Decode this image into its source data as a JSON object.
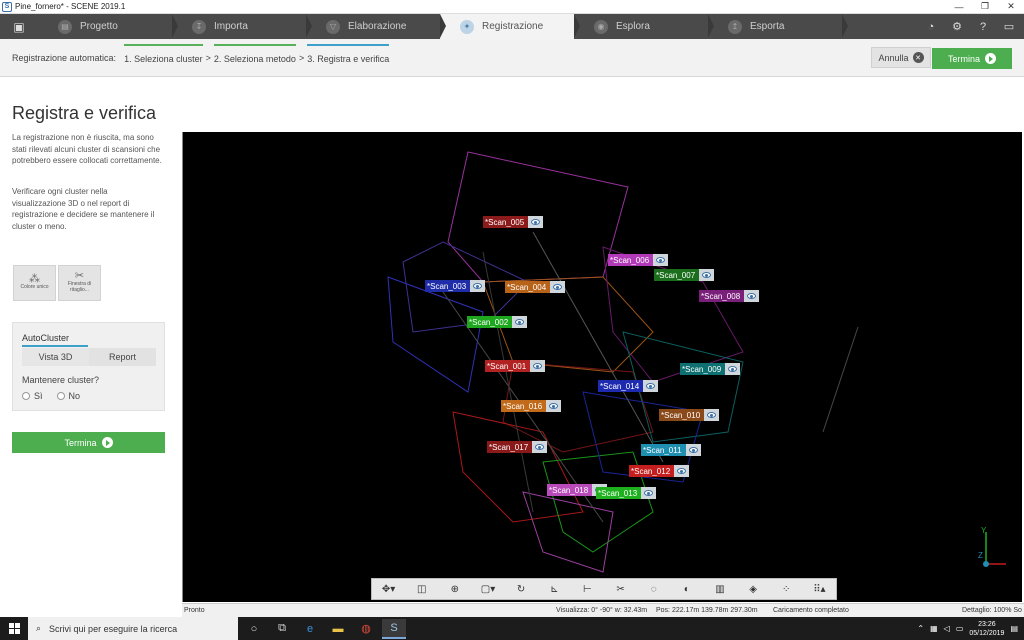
{
  "window": {
    "title": "Pine_fornero* - SCENE 2019.1",
    "app_icon": "S"
  },
  "workflow": {
    "steps": [
      {
        "label": "Progetto",
        "icon": "folder-icon"
      },
      {
        "label": "Importa",
        "icon": "import-icon"
      },
      {
        "label": "Elaborazione",
        "icon": "funnel-icon"
      },
      {
        "label": "Registrazione",
        "icon": "registration-icon",
        "active": true
      },
      {
        "label": "Esplora",
        "icon": "explore-icon"
      },
      {
        "label": "Esporta",
        "icon": "export-icon"
      }
    ]
  },
  "subheader": {
    "label": "Registrazione automatica:",
    "crumbs": [
      "1. Seleziona cluster",
      "2. Seleziona metodo",
      "3. Registra e verifica"
    ],
    "separator": ">",
    "cancel_label": "Annulla",
    "finish_label": "Termina"
  },
  "left": {
    "title": "Registra e verifica",
    "para1": "La registrazione non è riuscita, ma sono stati rilevati alcuni cluster di scansioni che potrebbero essere collocati correttamente.",
    "para2": "Verificare ogni cluster nella visualizzazione 3D o nel report di registrazione e decidere se mantenere il cluster o meno.",
    "tool1": "Colore unico",
    "tool2": "Finestra di ritaglio...",
    "autocluster": {
      "title": "AutoCluster",
      "tab_3d": "Vista 3D",
      "tab_report": "Report",
      "question": "Mantenere cluster?",
      "yes": "Sì",
      "no": "No"
    },
    "finish_label": "Termina"
  },
  "scans": [
    {
      "label": "*Scan_005",
      "color": "#8b1a1a"
    },
    {
      "label": "*Scan_006",
      "color": "#b23ab8"
    },
    {
      "label": "*Scan_007",
      "color": "#1b6e1b"
    },
    {
      "label": "*Scan_008",
      "color": "#7a1f7a"
    },
    {
      "label": "*Scan_003",
      "color": "#1f2ea8"
    },
    {
      "label": "*Scan_004",
      "color": "#b8631a"
    },
    {
      "label": "*Scan_002",
      "color": "#1ea61e"
    },
    {
      "label": "*Scan_001",
      "color": "#b22222"
    },
    {
      "label": "*Scan_009",
      "color": "#0e7070"
    },
    {
      "label": "*Scan_014",
      "color": "#1e2bb0"
    },
    {
      "label": "*Scan_016",
      "color": "#c06a1a"
    },
    {
      "label": "*Scan_010",
      "color": "#8a4a1a"
    },
    {
      "label": "*Scan_017",
      "color": "#8a1a1a"
    },
    {
      "label": "*Scan_011",
      "color": "#1e8fb0"
    },
    {
      "label": "*Scan_012",
      "color": "#c41e1e"
    },
    {
      "label": "*Scan_018",
      "color": "#b84aba"
    },
    {
      "label": "*Scan_013",
      "color": "#1eb01e"
    }
  ],
  "statusbar": {
    "state": "Pronto",
    "view": "Visualizza: 0° -90° w: 32.43m",
    "pos": "Pos: 222.17m 139.78m 297.30m",
    "loading": "Caricamento completato",
    "detail": "Dettaglio: 100% So"
  },
  "taskbar": {
    "search_placeholder": "Scrivi qui per eseguire la ricerca",
    "time": "23:26",
    "date": "05/12/2019"
  },
  "axis": {
    "y": "Y",
    "z": "Z"
  }
}
